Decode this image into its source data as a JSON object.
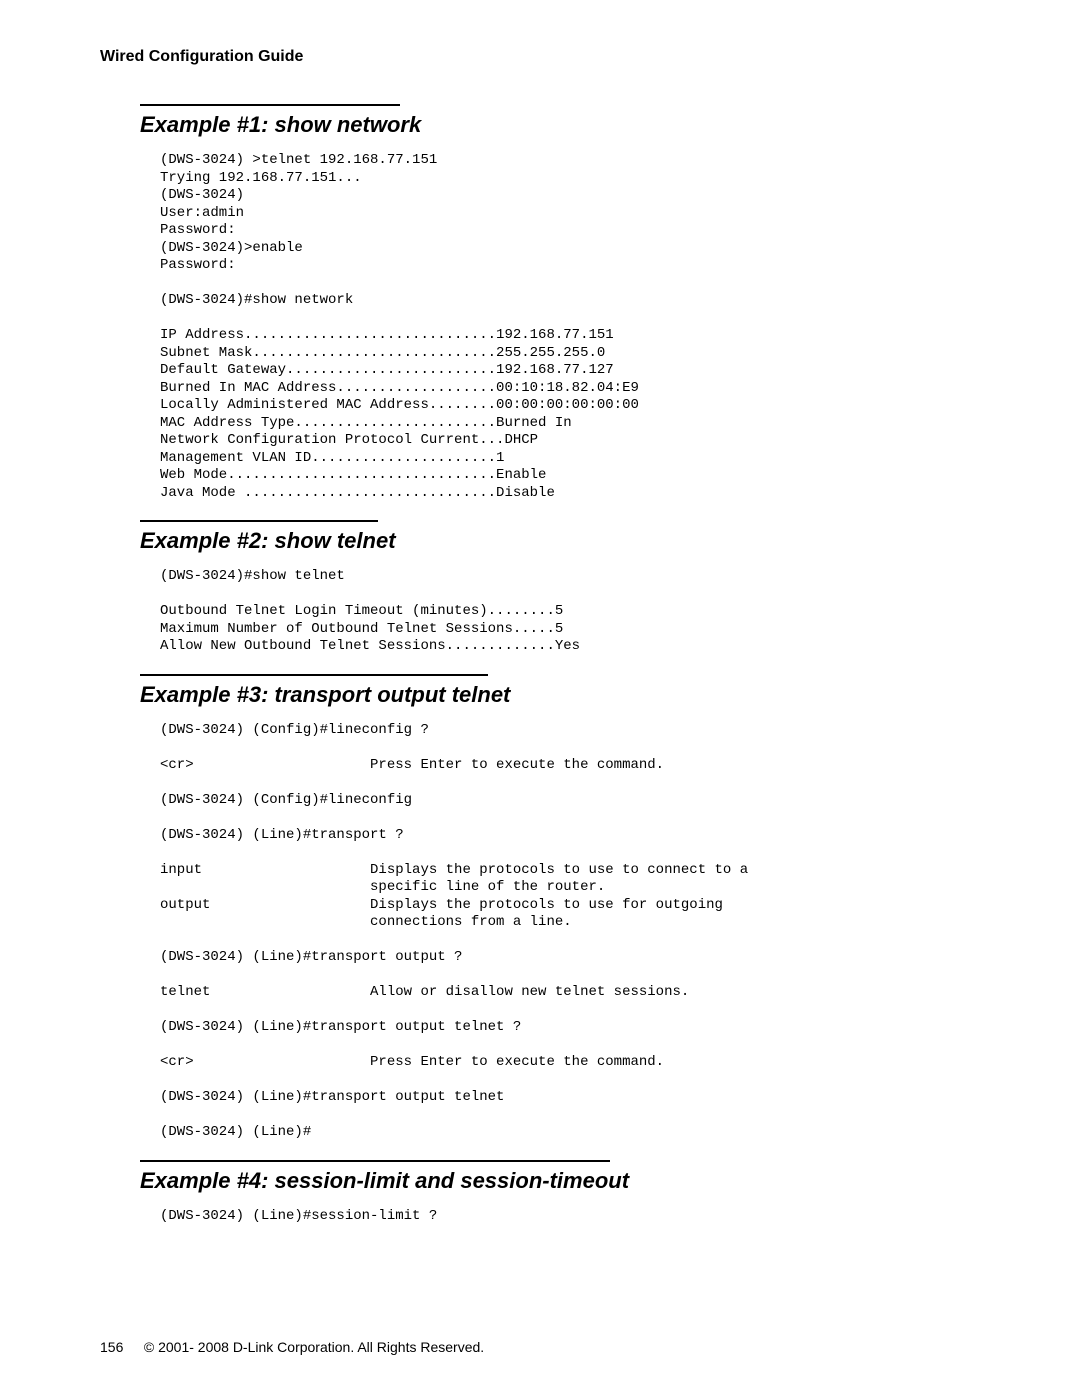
{
  "header": {
    "title": "Wired Configuration Guide"
  },
  "sections": [
    {
      "ruleWidth": "260px",
      "heading": "Example #1: show network",
      "code": "(DWS-3024) >telnet 192.168.77.151\nTrying 192.168.77.151...\n(DWS-3024)\nUser:admin\nPassword:\n(DWS-3024)>enable\nPassword:\n\n(DWS-3024)#show network\n\nIP Address..............................192.168.77.151\nSubnet Mask.............................255.255.255.0\nDefault Gateway.........................192.168.77.127\nBurned In MAC Address...................00:10:18.82.04:E9\nLocally Administered MAC Address........00:00:00:00:00:00\nMAC Address Type........................Burned In\nNetwork Configuration Protocol Current...DHCP\nManagement VLAN ID......................1\nWeb Mode................................Enable\nJava Mode ..............................Disable"
    },
    {
      "ruleWidth": "238px",
      "heading": "Example #2: show telnet",
      "code": "(DWS-3024)#show telnet\n\nOutbound Telnet Login Timeout (minutes)........5\nMaximum Number of Outbound Telnet Sessions.....5\nAllow New Outbound Telnet Sessions.............Yes"
    },
    {
      "ruleWidth": "348px",
      "heading": "Example #3: transport output telnet",
      "code": "(DWS-3024) (Config)#lineconfig ?\n\n<cr>                     Press Enter to execute the command.\n\n(DWS-3024) (Config)#lineconfig\n\n(DWS-3024) (Line)#transport ?\n\ninput                    Displays the protocols to use to connect to a\n                         specific line of the router.\noutput                   Displays the protocols to use for outgoing\n                         connections from a line.\n\n(DWS-3024) (Line)#transport output ?\n\ntelnet                   Allow or disallow new telnet sessions.\n\n(DWS-3024) (Line)#transport output telnet ?\n\n<cr>                     Press Enter to execute the command.\n\n(DWS-3024) (Line)#transport output telnet\n\n(DWS-3024) (Line)#"
    },
    {
      "ruleWidth": "470px",
      "heading": "Example #4: session-limit and session-timeout",
      "code": "(DWS-3024) (Line)#session-limit ?"
    }
  ],
  "footer": {
    "pageNumber": "156",
    "copyright": "© 2001- 2008 D-Link Corporation. All Rights Reserved."
  }
}
